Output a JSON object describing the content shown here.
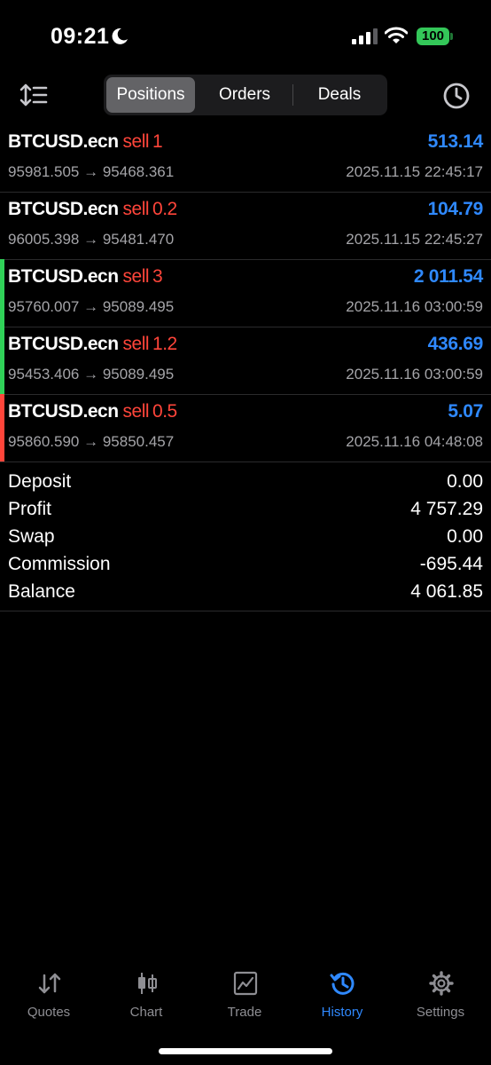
{
  "status_bar": {
    "time": "09:21",
    "battery": "100",
    "icons": [
      "moon-icon",
      "signal-icon",
      "wifi-icon",
      "battery-icon"
    ]
  },
  "toolbar": {
    "sort_icon": "sort-icon",
    "tabs": [
      {
        "label": "Positions",
        "active": true
      },
      {
        "label": "Orders",
        "active": false
      },
      {
        "label": "Deals",
        "active": false
      }
    ],
    "history_icon": "clock-icon"
  },
  "positions": [
    {
      "symbol": "BTCUSD.ecn",
      "side": "sell",
      "volume": "1",
      "profit": "513.14",
      "open_price": "95981.505",
      "arrow": "→",
      "close_price": "95468.361",
      "time": "2025.11.15 22:45:17",
      "bar_color": ""
    },
    {
      "symbol": "BTCUSD.ecn",
      "side": "sell",
      "volume": "0.2",
      "profit": "104.79",
      "open_price": "96005.398",
      "arrow": "→",
      "close_price": "95481.470",
      "time": "2025.11.15 22:45:27",
      "bar_color": ""
    },
    {
      "symbol": "BTCUSD.ecn",
      "side": "sell",
      "volume": "3",
      "profit": "2 011.54",
      "open_price": "95760.007",
      "arrow": "→",
      "close_price": "95089.495",
      "time": "2025.11.16 03:00:59",
      "bar_color": "#30d158"
    },
    {
      "symbol": "BTCUSD.ecn",
      "side": "sell",
      "volume": "1.2",
      "profit": "436.69",
      "open_price": "95453.406",
      "arrow": "→",
      "close_price": "95089.495",
      "time": "2025.11.16 03:00:59",
      "bar_color": "#30d158"
    },
    {
      "symbol": "BTCUSD.ecn",
      "side": "sell",
      "volume": "0.5",
      "profit": "5.07",
      "open_price": "95860.590",
      "arrow": "→",
      "close_price": "95850.457",
      "time": "2025.11.16 04:48:08",
      "bar_color": "#ff453a"
    }
  ],
  "summary": [
    {
      "label": "Deposit",
      "value": "0.00"
    },
    {
      "label": "Profit",
      "value": "4 757.29"
    },
    {
      "label": "Swap",
      "value": "0.00"
    },
    {
      "label": "Commission",
      "value": "-695.44"
    },
    {
      "label": "Balance",
      "value": "4 061.85"
    }
  ],
  "tab_bar": [
    {
      "label": "Quotes",
      "icon": "quotes-icon",
      "active": false
    },
    {
      "label": "Chart",
      "icon": "chart-icon",
      "active": false
    },
    {
      "label": "Trade",
      "icon": "trade-icon",
      "active": false
    },
    {
      "label": "History",
      "icon": "history-icon",
      "active": true
    },
    {
      "label": "Settings",
      "icon": "settings-icon",
      "active": false
    }
  ],
  "colors": {
    "accent": "#2f89ff",
    "sell": "#ff453a",
    "profit_bar": "#30d158",
    "loss_bar": "#ff453a",
    "battery": "#34c759"
  }
}
